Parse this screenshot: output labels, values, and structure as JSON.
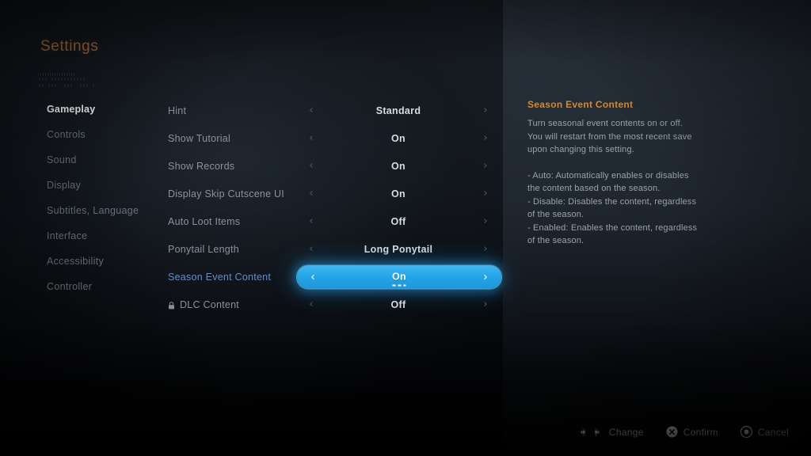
{
  "page": {
    "title": "Settings",
    "decorative_text": "▮▮▮ ▮▮▮▮▮▮▮▮▮▮▮\n▮▮.▮▮▮  ▮▮▮  ▮▮▮ ▮",
    "accent_title_color": "#a8754a",
    "highlight_color": "#29abe8",
    "desc_title_color": "#d4892f",
    "selected_label_color": "#5b8fd4"
  },
  "sidebar": {
    "items": [
      {
        "label": "Gameplay",
        "active": true
      },
      {
        "label": "Controls",
        "active": false
      },
      {
        "label": "Sound",
        "active": false
      },
      {
        "label": "Display",
        "active": false
      },
      {
        "label": "Subtitles, Language",
        "active": false
      },
      {
        "label": "Interface",
        "active": false
      },
      {
        "label": "Accessibility",
        "active": false
      },
      {
        "label": "Controller",
        "active": false
      }
    ]
  },
  "options": {
    "prev_icon": "chevron-left-icon",
    "next_icon": "chevron-right-icon",
    "rows": [
      {
        "label": "Hint",
        "value": "Standard",
        "selected": false,
        "locked": false
      },
      {
        "label": "Show Tutorial",
        "value": "On",
        "selected": false,
        "locked": false
      },
      {
        "label": "Show Records",
        "value": "On",
        "selected": false,
        "locked": false
      },
      {
        "label": "Display Skip Cutscene UI",
        "value": "On",
        "selected": false,
        "locked": false
      },
      {
        "label": "Auto Loot Items",
        "value": "Off",
        "selected": false,
        "locked": false
      },
      {
        "label": "Ponytail Length",
        "value": "Long Ponytail",
        "selected": false,
        "locked": false
      },
      {
        "label": "Season Event Content",
        "value": "On",
        "selected": true,
        "locked": false
      },
      {
        "label": "DLC Content",
        "value": "Off",
        "selected": false,
        "locked": true
      }
    ]
  },
  "description": {
    "title": "Season Event Content",
    "body": "Turn seasonal event contents on or off. You will restart from the most recent save upon changing this setting.",
    "bullets": "- Auto: Automatically enables or disables the content based on the season.\n- Disable: Disables the content, regardless of the season.\n- Enabled: Enables the content, regardless of the season."
  },
  "footer": {
    "buttons": [
      {
        "label": "Change",
        "icon": "dpad-left-right-icon"
      },
      {
        "label": "Confirm",
        "icon": "cross-button-icon"
      },
      {
        "label": "Cancel",
        "icon": "circle-button-icon"
      }
    ]
  }
}
